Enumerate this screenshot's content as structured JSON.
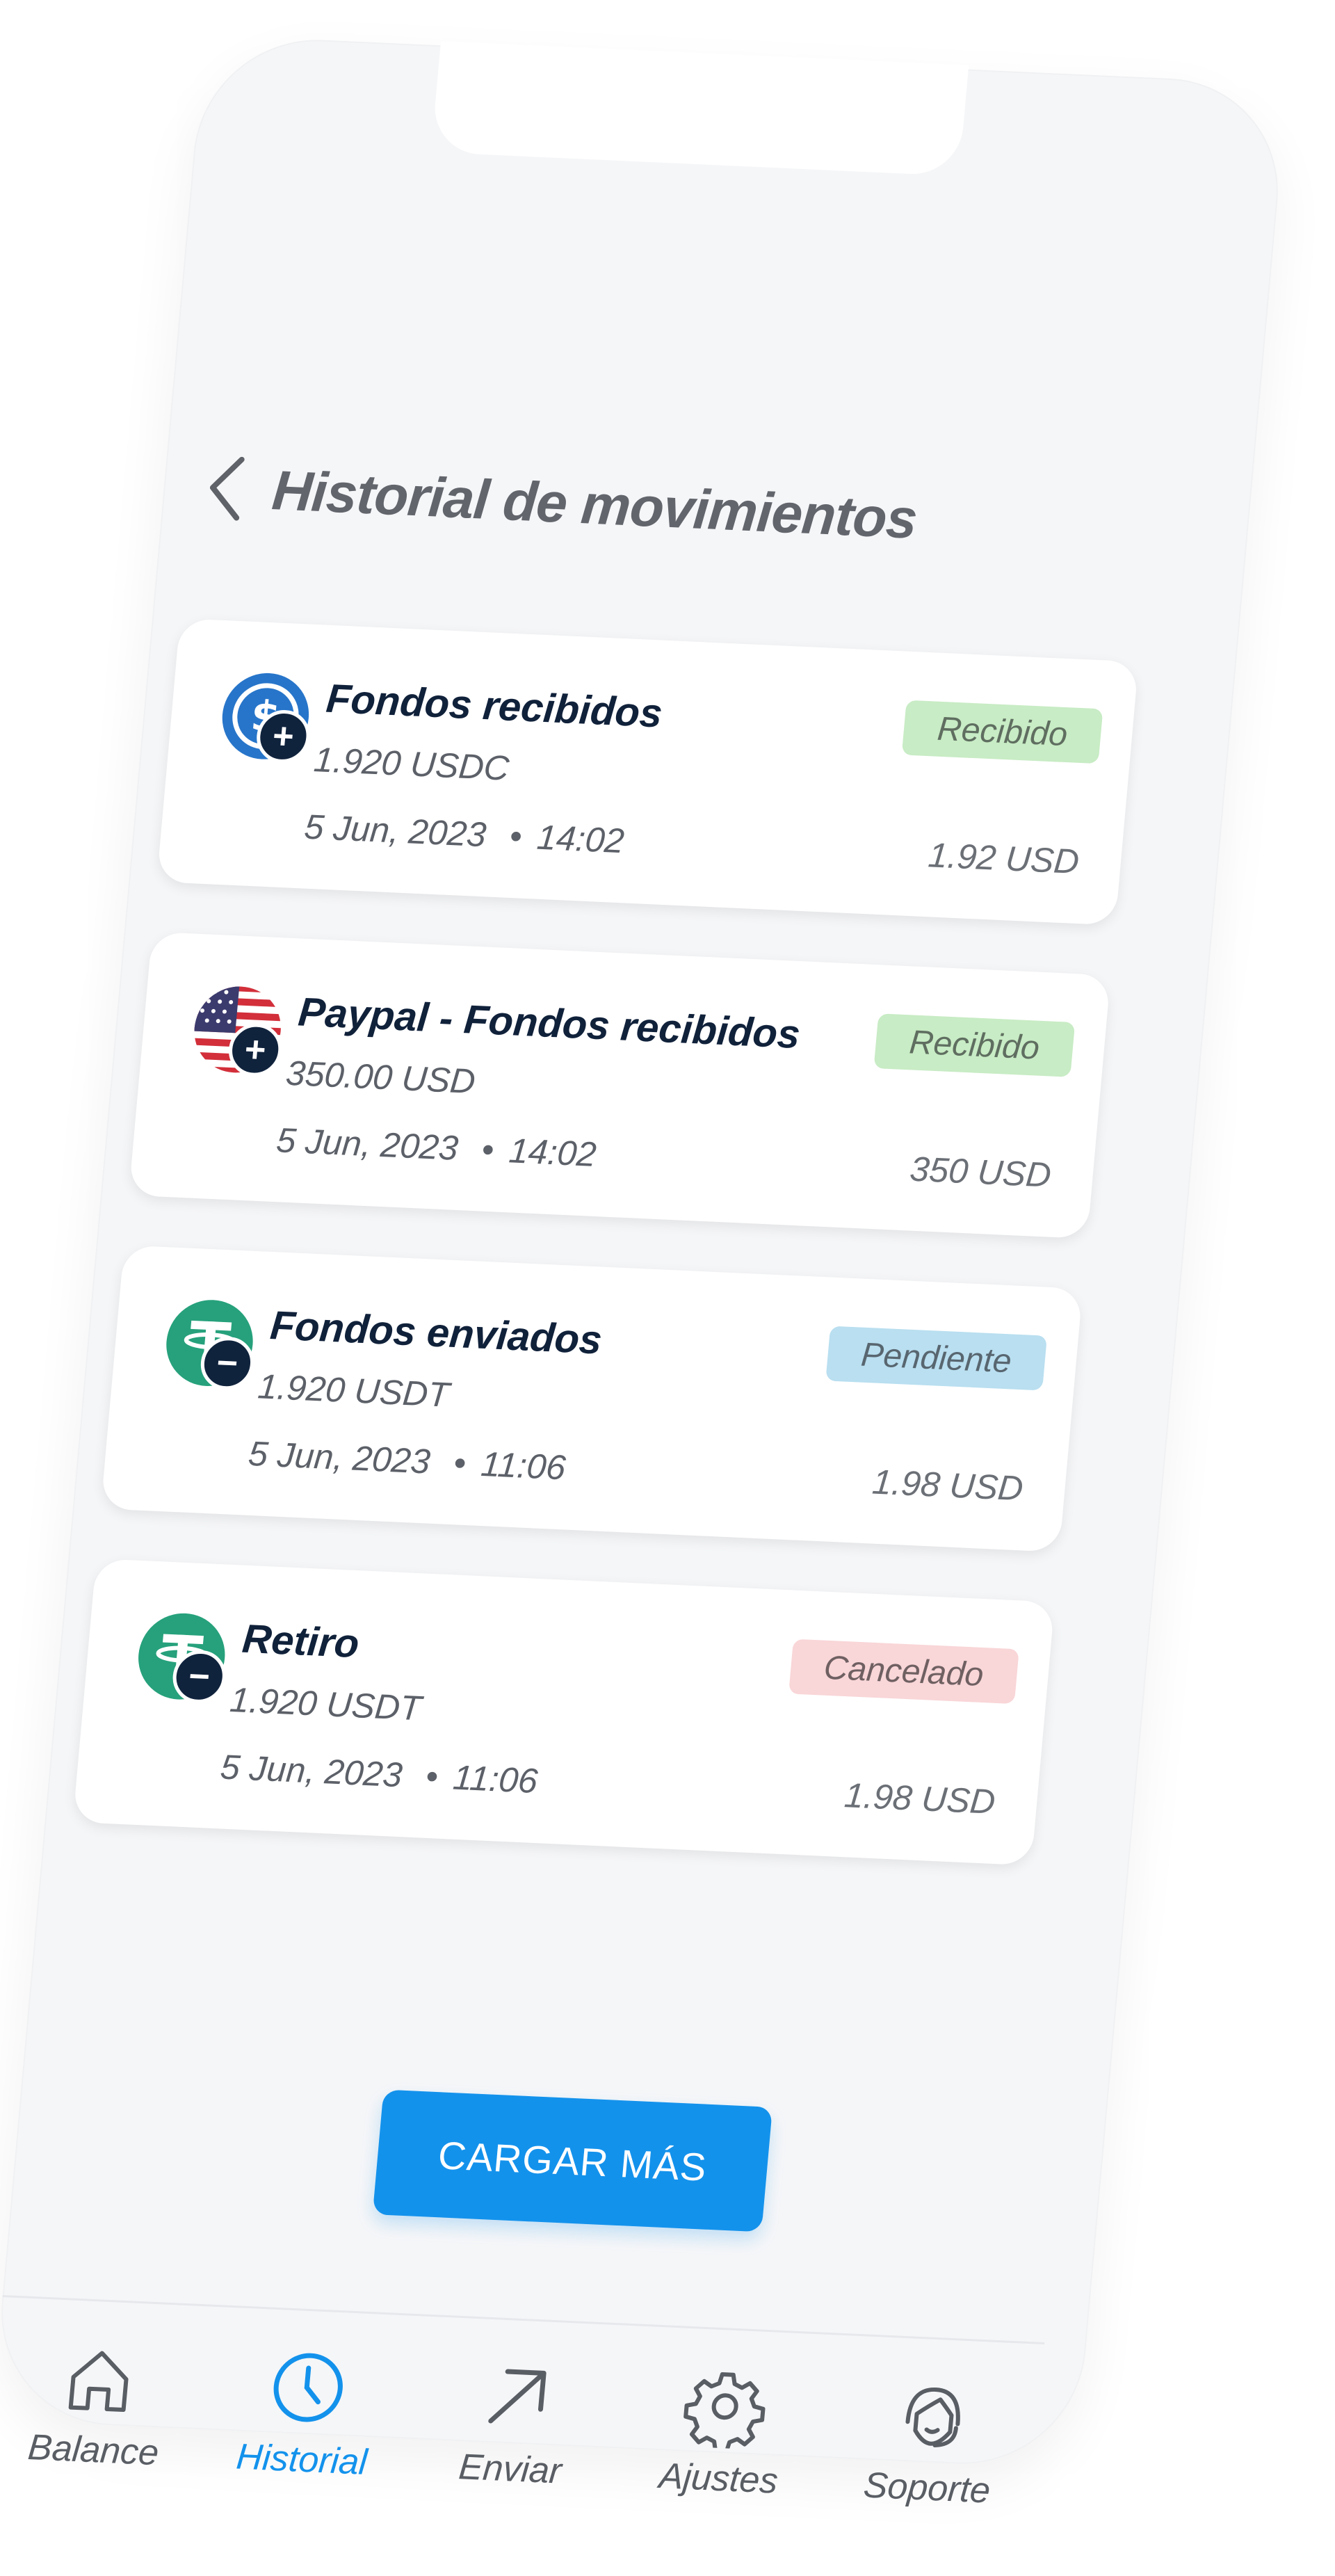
{
  "header": {
    "title": "Historial de movimientos"
  },
  "transactions": [
    {
      "title": "Fondos recibidos",
      "amount": "1.920 USDC",
      "date": "5 Jun, 2023",
      "time": "14:02",
      "usd": "1.92 USD",
      "status": "Recibido",
      "icon": "usdc-coin-icon",
      "op": "+"
    },
    {
      "title": "Paypal - Fondos recibidos",
      "amount": "350.00 USD",
      "date": "5 Jun, 2023",
      "time": "14:02",
      "usd": "350 USD",
      "status": "Recibido",
      "icon": "us-flag-icon",
      "op": "+"
    },
    {
      "title": "Fondos enviados",
      "amount": "1.920 USDT",
      "date": "5 Jun, 2023",
      "time": "11:06",
      "usd": "1.98 USD",
      "status": "Pendiente",
      "icon": "tether-coin-icon",
      "op": "−"
    },
    {
      "title": "Retiro",
      "amount": "1.920 USDT",
      "date": "5 Jun, 2023",
      "time": "11:06",
      "usd": "1.98 USD",
      "status": "Cancelado",
      "icon": "tether-coin-icon",
      "op": "−"
    }
  ],
  "dot": "•",
  "load_more": "CARGAR MÁS",
  "nav": [
    {
      "label": "Balance",
      "icon": "home-icon",
      "active": false
    },
    {
      "label": "Historial",
      "icon": "clock-icon",
      "active": true
    },
    {
      "label": "Enviar",
      "icon": "arrow-up-right-icon",
      "active": false
    },
    {
      "label": "Ajustes",
      "icon": "gear-icon",
      "active": false
    },
    {
      "label": "Soporte",
      "icon": "headset-icon",
      "active": false
    }
  ],
  "colors": {
    "accent": "#1392ec",
    "status_recibido": "#c8ecc5",
    "status_pendiente": "#b9dff0",
    "status_cancelado": "#f9d6d8",
    "tether": "#26a17b",
    "usdc": "#2775ca"
  }
}
